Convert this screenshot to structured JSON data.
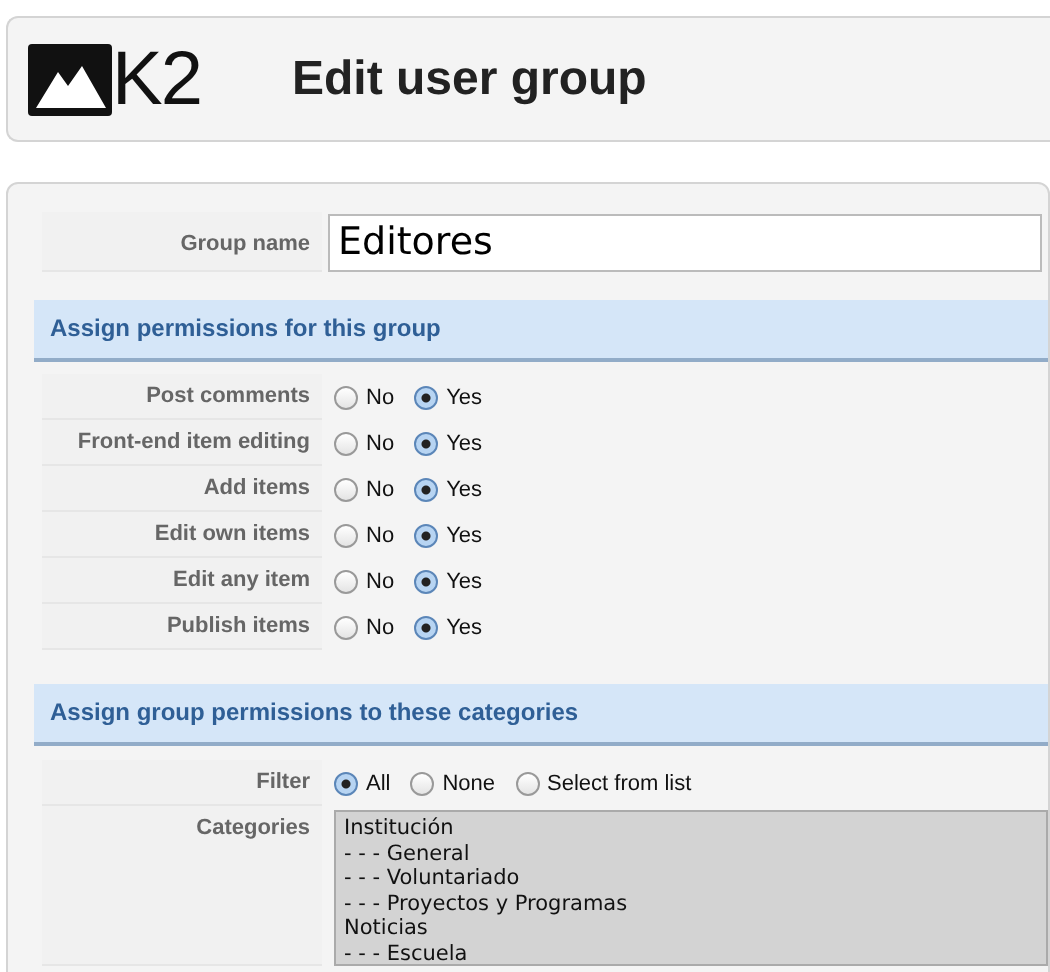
{
  "header": {
    "logo_text": "K2",
    "title": "Edit user group"
  },
  "group_name": {
    "label": "Group name",
    "value": "Editores"
  },
  "permissions": {
    "heading": "Assign permissions for this group",
    "rows": [
      {
        "label": "Post comments",
        "options": [
          {
            "label": "No",
            "selected": false
          },
          {
            "label": "Yes",
            "selected": true
          }
        ]
      },
      {
        "label": "Front-end item editing",
        "options": [
          {
            "label": "No",
            "selected": false
          },
          {
            "label": "Yes",
            "selected": true
          }
        ]
      },
      {
        "label": "Add items",
        "options": [
          {
            "label": "No",
            "selected": false
          },
          {
            "label": "Yes",
            "selected": true
          }
        ]
      },
      {
        "label": "Edit own items",
        "options": [
          {
            "label": "No",
            "selected": false
          },
          {
            "label": "Yes",
            "selected": true
          }
        ]
      },
      {
        "label": "Edit any item",
        "options": [
          {
            "label": "No",
            "selected": false
          },
          {
            "label": "Yes",
            "selected": true
          }
        ]
      },
      {
        "label": "Publish items",
        "options": [
          {
            "label": "No",
            "selected": false
          },
          {
            "label": "Yes",
            "selected": true
          }
        ]
      }
    ]
  },
  "category_permissions": {
    "heading": "Assign group permissions to these categories",
    "filter": {
      "label": "Filter",
      "options": [
        {
          "label": "All",
          "selected": true
        },
        {
          "label": "None",
          "selected": false
        },
        {
          "label": "Select from list",
          "selected": false
        }
      ]
    },
    "categories": {
      "label": "Categories",
      "disabled": true,
      "items": [
        {
          "label": "Institución",
          "children": [
            {
              "label": "- - - General"
            },
            {
              "label": "- - - Voluntariado"
            },
            {
              "label": "- - - Proyectos y Programas"
            }
          ]
        },
        {
          "label": "Noticias",
          "children": [
            {
              "label": "- - - Escuela"
            }
          ]
        }
      ]
    }
  }
}
